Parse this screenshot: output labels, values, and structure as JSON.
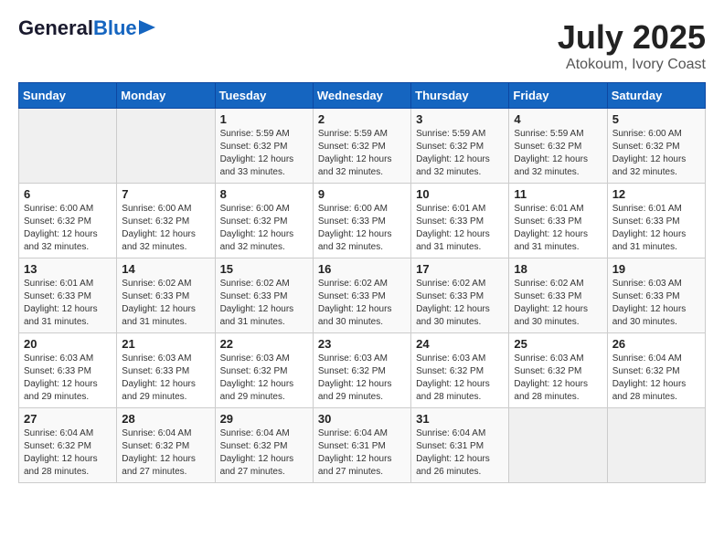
{
  "header": {
    "logo_line1": "General",
    "logo_line2": "Blue",
    "title": "July 2025",
    "subtitle": "Atokoum, Ivory Coast"
  },
  "weekdays": [
    "Sunday",
    "Monday",
    "Tuesday",
    "Wednesday",
    "Thursday",
    "Friday",
    "Saturday"
  ],
  "weeks": [
    [
      {
        "day": "",
        "info": ""
      },
      {
        "day": "",
        "info": ""
      },
      {
        "day": "1",
        "info": "Sunrise: 5:59 AM\nSunset: 6:32 PM\nDaylight: 12 hours and 33 minutes."
      },
      {
        "day": "2",
        "info": "Sunrise: 5:59 AM\nSunset: 6:32 PM\nDaylight: 12 hours and 32 minutes."
      },
      {
        "day": "3",
        "info": "Sunrise: 5:59 AM\nSunset: 6:32 PM\nDaylight: 12 hours and 32 minutes."
      },
      {
        "day": "4",
        "info": "Sunrise: 5:59 AM\nSunset: 6:32 PM\nDaylight: 12 hours and 32 minutes."
      },
      {
        "day": "5",
        "info": "Sunrise: 6:00 AM\nSunset: 6:32 PM\nDaylight: 12 hours and 32 minutes."
      }
    ],
    [
      {
        "day": "6",
        "info": "Sunrise: 6:00 AM\nSunset: 6:32 PM\nDaylight: 12 hours and 32 minutes."
      },
      {
        "day": "7",
        "info": "Sunrise: 6:00 AM\nSunset: 6:32 PM\nDaylight: 12 hours and 32 minutes."
      },
      {
        "day": "8",
        "info": "Sunrise: 6:00 AM\nSunset: 6:32 PM\nDaylight: 12 hours and 32 minutes."
      },
      {
        "day": "9",
        "info": "Sunrise: 6:00 AM\nSunset: 6:33 PM\nDaylight: 12 hours and 32 minutes."
      },
      {
        "day": "10",
        "info": "Sunrise: 6:01 AM\nSunset: 6:33 PM\nDaylight: 12 hours and 31 minutes."
      },
      {
        "day": "11",
        "info": "Sunrise: 6:01 AM\nSunset: 6:33 PM\nDaylight: 12 hours and 31 minutes."
      },
      {
        "day": "12",
        "info": "Sunrise: 6:01 AM\nSunset: 6:33 PM\nDaylight: 12 hours and 31 minutes."
      }
    ],
    [
      {
        "day": "13",
        "info": "Sunrise: 6:01 AM\nSunset: 6:33 PM\nDaylight: 12 hours and 31 minutes."
      },
      {
        "day": "14",
        "info": "Sunrise: 6:02 AM\nSunset: 6:33 PM\nDaylight: 12 hours and 31 minutes."
      },
      {
        "day": "15",
        "info": "Sunrise: 6:02 AM\nSunset: 6:33 PM\nDaylight: 12 hours and 31 minutes."
      },
      {
        "day": "16",
        "info": "Sunrise: 6:02 AM\nSunset: 6:33 PM\nDaylight: 12 hours and 30 minutes."
      },
      {
        "day": "17",
        "info": "Sunrise: 6:02 AM\nSunset: 6:33 PM\nDaylight: 12 hours and 30 minutes."
      },
      {
        "day": "18",
        "info": "Sunrise: 6:02 AM\nSunset: 6:33 PM\nDaylight: 12 hours and 30 minutes."
      },
      {
        "day": "19",
        "info": "Sunrise: 6:03 AM\nSunset: 6:33 PM\nDaylight: 12 hours and 30 minutes."
      }
    ],
    [
      {
        "day": "20",
        "info": "Sunrise: 6:03 AM\nSunset: 6:33 PM\nDaylight: 12 hours and 29 minutes."
      },
      {
        "day": "21",
        "info": "Sunrise: 6:03 AM\nSunset: 6:33 PM\nDaylight: 12 hours and 29 minutes."
      },
      {
        "day": "22",
        "info": "Sunrise: 6:03 AM\nSunset: 6:32 PM\nDaylight: 12 hours and 29 minutes."
      },
      {
        "day": "23",
        "info": "Sunrise: 6:03 AM\nSunset: 6:32 PM\nDaylight: 12 hours and 29 minutes."
      },
      {
        "day": "24",
        "info": "Sunrise: 6:03 AM\nSunset: 6:32 PM\nDaylight: 12 hours and 28 minutes."
      },
      {
        "day": "25",
        "info": "Sunrise: 6:03 AM\nSunset: 6:32 PM\nDaylight: 12 hours and 28 minutes."
      },
      {
        "day": "26",
        "info": "Sunrise: 6:04 AM\nSunset: 6:32 PM\nDaylight: 12 hours and 28 minutes."
      }
    ],
    [
      {
        "day": "27",
        "info": "Sunrise: 6:04 AM\nSunset: 6:32 PM\nDaylight: 12 hours and 28 minutes."
      },
      {
        "day": "28",
        "info": "Sunrise: 6:04 AM\nSunset: 6:32 PM\nDaylight: 12 hours and 27 minutes."
      },
      {
        "day": "29",
        "info": "Sunrise: 6:04 AM\nSunset: 6:32 PM\nDaylight: 12 hours and 27 minutes."
      },
      {
        "day": "30",
        "info": "Sunrise: 6:04 AM\nSunset: 6:31 PM\nDaylight: 12 hours and 27 minutes."
      },
      {
        "day": "31",
        "info": "Sunrise: 6:04 AM\nSunset: 6:31 PM\nDaylight: 12 hours and 26 minutes."
      },
      {
        "day": "",
        "info": ""
      },
      {
        "day": "",
        "info": ""
      }
    ]
  ]
}
